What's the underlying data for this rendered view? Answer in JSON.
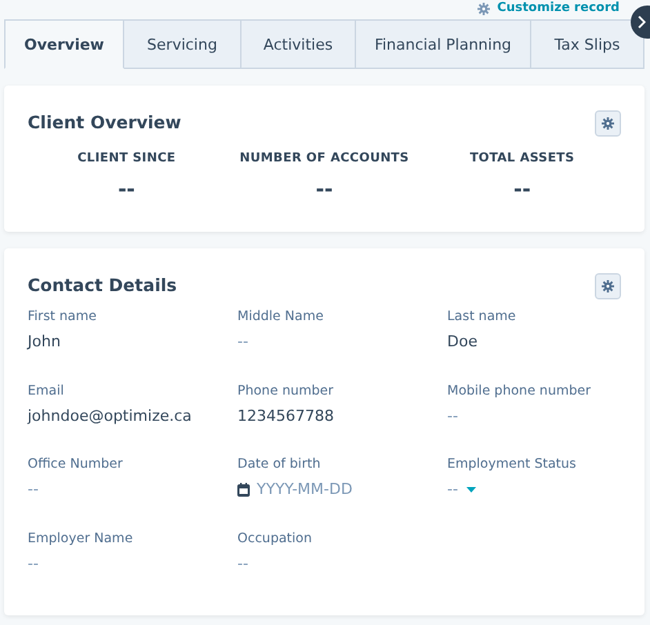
{
  "header": {
    "link": "Customize record"
  },
  "tabs": [
    {
      "label": "Overview",
      "selected": true
    },
    {
      "label": "Servicing",
      "selected": false
    },
    {
      "label": "Activities",
      "selected": false
    },
    {
      "label": "Financial Planning",
      "selected": false
    },
    {
      "label": "Tax Slips",
      "selected": false
    }
  ],
  "client_overview": {
    "title": "Client Overview",
    "stats": [
      {
        "label": "CLIENT SINCE",
        "value": "--"
      },
      {
        "label": "NUMBER OF ACCOUNTS",
        "value": "--"
      },
      {
        "label": "TOTAL ASSETS",
        "value": "--"
      }
    ]
  },
  "contact_details": {
    "title": "Contact Details",
    "fields": [
      {
        "label": "First name",
        "kind": "text",
        "value": "John"
      },
      {
        "label": "Middle Name",
        "kind": "empty",
        "value": "--"
      },
      {
        "label": "Last name",
        "kind": "text",
        "value": "Doe"
      },
      {
        "label": "Email",
        "kind": "text",
        "value": "johndoe@optimize.ca"
      },
      {
        "label": "Phone number",
        "kind": "text",
        "value": "1234567788"
      },
      {
        "label": "Mobile phone number",
        "kind": "empty",
        "value": "--"
      },
      {
        "label": "Office Number",
        "kind": "empty",
        "value": "--"
      },
      {
        "label": "Date of birth",
        "kind": "date",
        "placeholder": "YYYY-MM-DD"
      },
      {
        "label": "Employment Status",
        "kind": "select",
        "value": "--"
      },
      {
        "label": "Employer Name",
        "kind": "empty",
        "value": "--"
      },
      {
        "label": "Occupation",
        "kind": "empty",
        "value": "--"
      }
    ]
  }
}
